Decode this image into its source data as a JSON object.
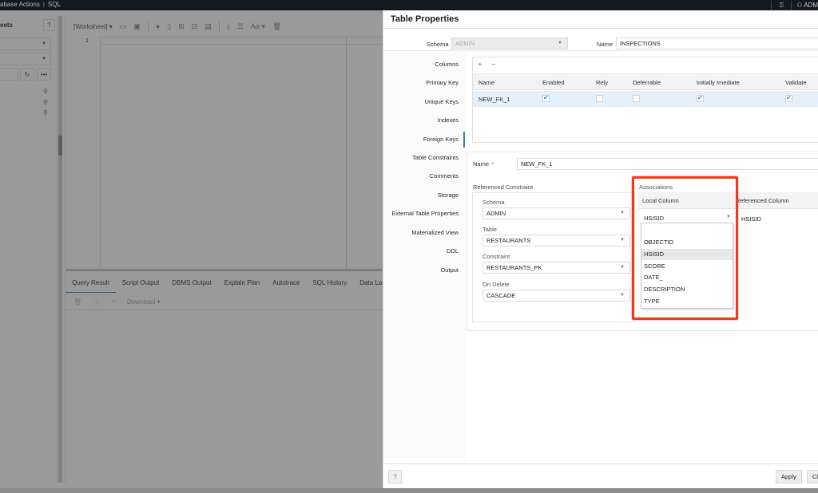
{
  "topbar": {
    "breadcrumb": [
      "abase Actions",
      "SQL"
    ],
    "user": "ADM"
  },
  "left_panel": {
    "title": "eets",
    "pins": 3
  },
  "editor": {
    "worksheet_label": "[Worksheet]",
    "line_numbers": [
      "1"
    ],
    "toolbar_icons": [
      "open-icon",
      "save-icon",
      "run-icon",
      "run-script-icon",
      "explain-plan-icon",
      "autotrace-icon",
      "sql-tuning-icon",
      "download-icon",
      "format-icon",
      "font-size-icon",
      "clear-icon"
    ],
    "font_label": "Aa"
  },
  "result_tabs": [
    "Query Result",
    "Script Output",
    "DBMS Output",
    "Explain Plan",
    "Autotrace",
    "SQL History",
    "Data Loadin"
  ],
  "result_tools": {
    "download_label": "Download"
  },
  "dialog": {
    "title": "Table Properties",
    "schema_label": "Schema",
    "schema_value": "ADMIN",
    "name_label": "Name",
    "name_value": "INSPECTIONS",
    "nav": [
      "Columns",
      "Primary Key",
      "Unique Keys",
      "Indexes",
      "Foreign Keys",
      "Table Constraints",
      "Comments",
      "Storage",
      "External Table Properties",
      "Materialized View",
      "DDL",
      "Output"
    ],
    "active_nav": "Foreign Keys",
    "fk_table": {
      "add_label": "+",
      "remove_label": "−",
      "columns": [
        "Name",
        "Enabled",
        "Rely",
        "Deferrable",
        "Initially Imediate",
        "Validate"
      ],
      "rows": [
        {
          "name": "NEW_FK_1",
          "enabled": true,
          "rely": false,
          "deferrable": false,
          "initially_immediate": true,
          "validate": true
        }
      ]
    },
    "fk_name_label": "Name",
    "fk_name_required": "*",
    "fk_name_value": "NEW_FK_1",
    "referenced_constraint": {
      "title": "Referenced Constraint",
      "schema_label": "Schema",
      "schema_value": "ADMIN",
      "table_label": "Table",
      "table_value": "RESTAURANTS",
      "constraint_label": "Constraint",
      "constraint_value": "RESTAURANTS_PK",
      "on_delete_label": "On Delete",
      "on_delete_value": "CASCADE"
    },
    "associations": {
      "title": "Associations",
      "local_column_header": "Local Column",
      "referenced_column_header": "Referenced Column",
      "local_column_value": "HSISID",
      "referenced_column_value": "HSISID",
      "dropdown_options": [
        "",
        "OBJECTID",
        "HSISID",
        "SCORE",
        "DATE_",
        "DESCRIPTION",
        "TYPE"
      ],
      "highlighted_option": "HSISID"
    },
    "footer": {
      "apply_label": "Apply",
      "close_label": "Close"
    },
    "highlight_color": "#f23a1a",
    "accent_color": "#3a7fc1"
  }
}
